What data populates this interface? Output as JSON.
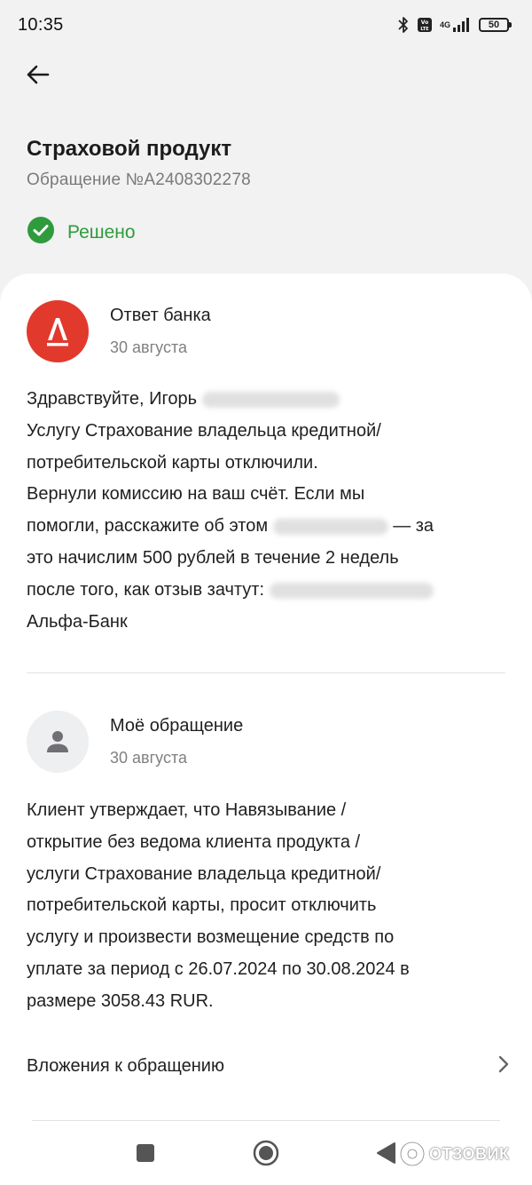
{
  "status_bar": {
    "time": "10:35",
    "network": "4G",
    "battery": "50"
  },
  "header": {
    "title": "Страховой продукт",
    "ticket": "Обращение №A2408302278"
  },
  "status": {
    "label": "Решено",
    "color": "#2e9b3c"
  },
  "bank_message": {
    "author": "Ответ банка",
    "date": "30 августа",
    "line1": "Здравствуйте, Игорь",
    "line2": "Услугу Страхование владельца кредитной/",
    "line3": "потребительской карты отключили.",
    "line4": "Вернули комиссию на ваш счёт. Если мы",
    "line5a": "помогли, расскажите об этом",
    "line5b": "— за",
    "line6": "это начислим 500 рублей в течение 2 недель",
    "line7": "после того, как отзыв зачтут:",
    "line8": "Альфа-Банк",
    "brand_color": "#e2392d"
  },
  "user_message": {
    "author": "Моё обращение",
    "date": "30 августа",
    "line1": "Клиент утверждает, что Навязывание /",
    "line2": "открытие без ведома клиента продукта /",
    "line3": "услуги Страхование владельца кредитной/",
    "line4": "потребительской карты, просит отключить",
    "line5": "услугу и произвести возмещение средств по",
    "line6": "уплате за период с 26.07.2024 по 30.08.2024 в",
    "line7": "размере 3058.43 RUR."
  },
  "attachments": {
    "label": "Вложения к обращению"
  },
  "watermark": {
    "text": "ОТЗОВИК"
  }
}
